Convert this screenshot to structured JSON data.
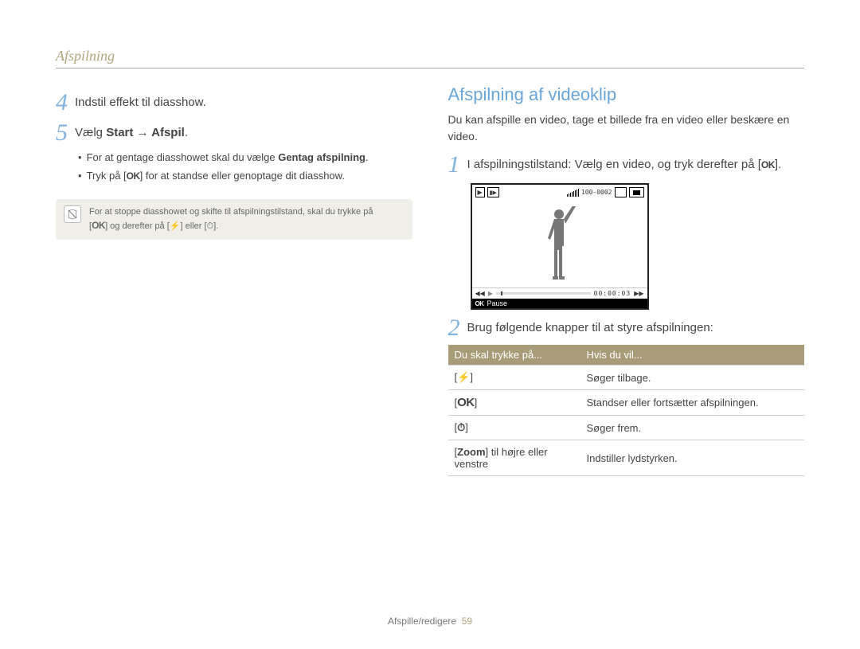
{
  "header": {
    "title": "Afspilning"
  },
  "left": {
    "step4": {
      "num": "4",
      "text": "Indstil effekt til diasshow."
    },
    "step5": {
      "num": "5",
      "text_prefix": "Vælg ",
      "text_bold": "Start → Afspil",
      "text_suffix": "."
    },
    "bullets": [
      {
        "prefix": "For at gentage diasshowet skal du vælge ",
        "bold": "Gentag afspilning",
        "suffix": "."
      },
      {
        "prefix": "Tryk på [",
        "ok": "OK",
        "suffix": "] for at standse eller genoptage dit diasshow."
      }
    ],
    "note": {
      "line1_a": "For at stoppe diasshowet og skifte til afspilningstilstand, skal du trykke på",
      "line2_a": "[",
      "ok": "OK",
      "line2_b": "] og derefter på [",
      "icon1": "⚡",
      "line2_c": "] eller [",
      "icon2": "⏱",
      "line2_d": "]."
    }
  },
  "right": {
    "heading": "Afspilning af videoklip",
    "intro": "Du kan afspille en video, tage et billede fra en video eller beskære en video.",
    "step1": {
      "num": "1",
      "text_a": "I afspilningstilstand: Vælg en video, og tryk derefter på [",
      "ok": "OK",
      "text_b": "]."
    },
    "screen": {
      "file_index": "100-0002",
      "time": "00:00:03",
      "ok": "OK",
      "pause": "Pause"
    },
    "step2": {
      "num": "2",
      "text": "Brug følgende knapper til at styre afspilningen:"
    },
    "table": {
      "headers": {
        "press": "Du skal trykke på...",
        "action": "Hvis du vil..."
      },
      "rows": [
        {
          "press_a": "[",
          "press_b": "⚡",
          "press_c": "]",
          "action": "Søger tilbage."
        },
        {
          "press_a": "[",
          "press_b": "OK",
          "press_c": "]",
          "action": "Standser eller fortsætter afspilningen."
        },
        {
          "press_a": "[",
          "press_b": "⏱",
          "press_c": "]",
          "action": "Søger frem."
        },
        {
          "press_a": "[",
          "press_b": "Zoom",
          "press_c": "] til højre eller venstre",
          "action": "Indstiller lydstyrken."
        }
      ]
    }
  },
  "footer": {
    "section": "Afspille/redigere",
    "page": "59"
  }
}
